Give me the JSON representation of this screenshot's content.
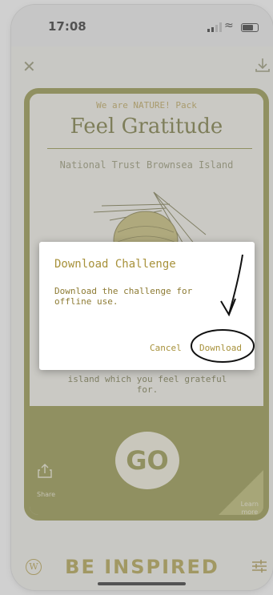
{
  "status_bar": {
    "time": "17:08"
  },
  "top_bar": {
    "close_icon": "close-icon",
    "download_icon": "download-icon"
  },
  "card": {
    "pack_label": "We are NATURE! Pack",
    "title": "Feel Gratitude",
    "location": "National Trust Brownsea Island",
    "description_line1": "island which you feel grateful",
    "description_line2": "for.",
    "go_label": "GO",
    "share_label": "Share",
    "learn_label_1": "Learn",
    "learn_label_2": "more"
  },
  "bottom_bar": {
    "logo_letter": "W",
    "title": "BE INSPIRED",
    "filter_icon": "sliders-icon"
  },
  "dialog": {
    "title": "Download Challenge",
    "message": "Download the challenge for offline use.",
    "cancel_label": "Cancel",
    "download_label": "Download"
  },
  "colors": {
    "olive": "#8b8a35",
    "gold": "#a7913a"
  }
}
